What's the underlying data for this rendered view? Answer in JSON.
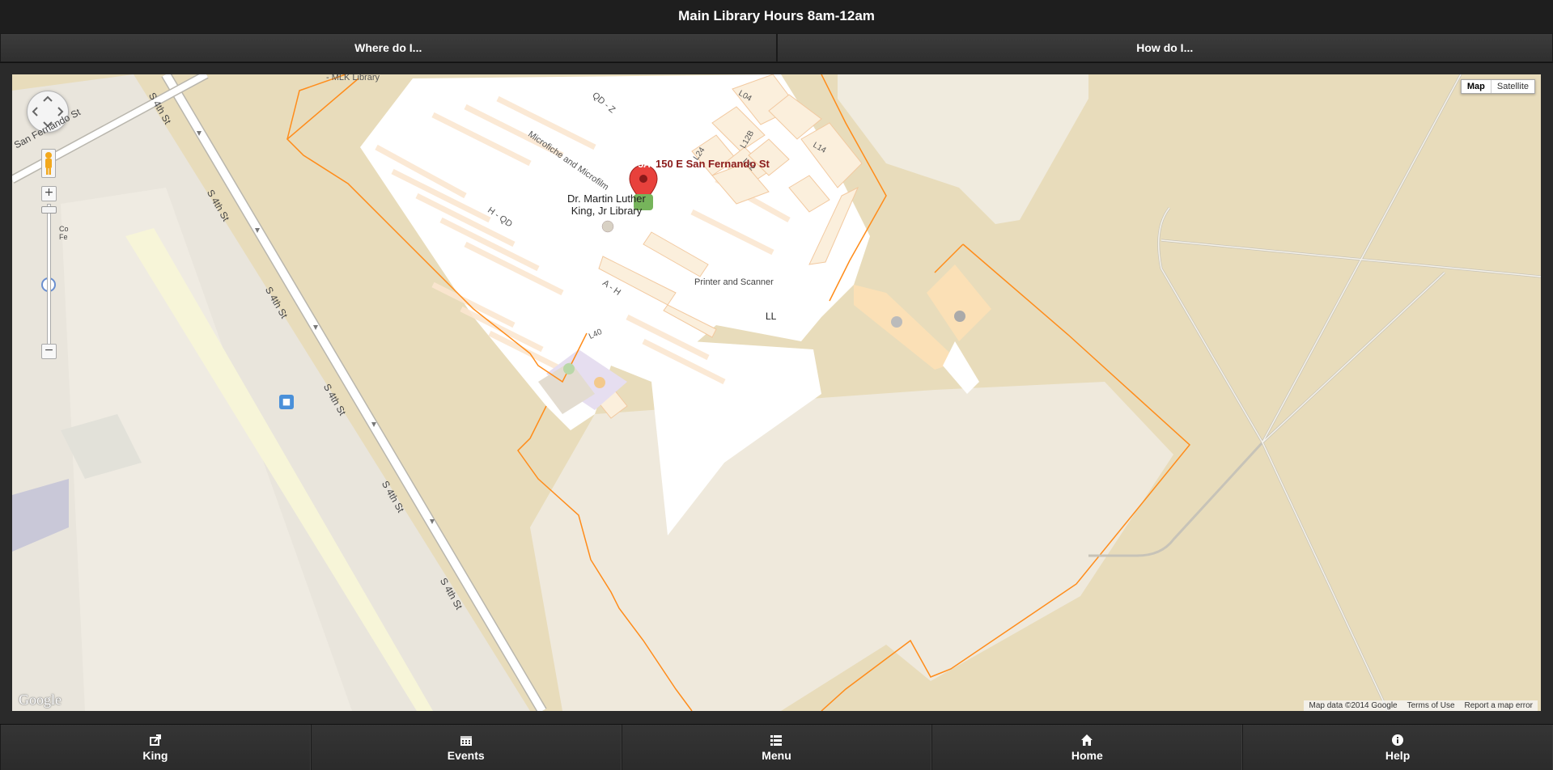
{
  "header": {
    "title": "Main Library Hours 8am-12am"
  },
  "navbar": {
    "where_label": "Where do I...",
    "how_label": "How do I..."
  },
  "map": {
    "type_buttons": {
      "map": "Map",
      "satellite": "Satellite"
    },
    "marker_address": "150 E San Fernando St",
    "marker_badge": "5A",
    "poi_name_line1": "Dr. Martin Luther",
    "poi_name_line2": "King, Jr Library",
    "top_label": "- MLK Library",
    "road_labels": {
      "fernando": "San Fernando St",
      "fourth": "S 4th St"
    },
    "floor_labels": {
      "qd_z": "QD - Z",
      "microfiche": "Microfiche  and Microfilm",
      "h_qd": "H - QD",
      "a_h": "A - H",
      "printer": "Printer and Scanner",
      "ll": "LL",
      "l04": "L04",
      "l24": "L24",
      "l12b": "L12B",
      "l12": "L12",
      "l14": "L14",
      "l40": "L40"
    },
    "side_label": "Co\nFe",
    "attribution": {
      "data": "Map data ©2014 Google",
      "terms": "Terms of Use",
      "report": "Report a map error"
    },
    "logo": "Google",
    "zoom_in": "+",
    "zoom_out": "−"
  },
  "footer": {
    "items": [
      {
        "label": "King",
        "icon": "share-icon"
      },
      {
        "label": "Events",
        "icon": "calendar-icon"
      },
      {
        "label": "Menu",
        "icon": "list-icon"
      },
      {
        "label": "Home",
        "icon": "home-icon"
      },
      {
        "label": "Help",
        "icon": "info-icon"
      }
    ]
  },
  "colors": {
    "header_bg": "#1e1e1e",
    "map_land": "#e8dcbb",
    "building_outline": "#ff8c1a",
    "marker": "#e8413c",
    "marker_text": "#8a1a1a"
  }
}
